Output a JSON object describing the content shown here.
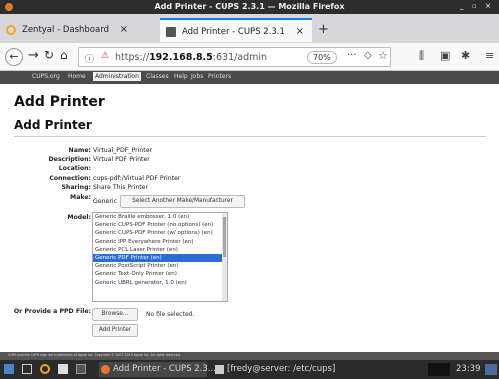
{
  "window": {
    "title": "Add Printer - CUPS 2.3.1 — Mozilla Firefox",
    "controls": "_ ▫ ×"
  },
  "tabs": [
    {
      "label": "Zentyal - Dashboard",
      "close": "×"
    },
    {
      "label": "Add Printer - CUPS 2.3.1",
      "close": "×"
    }
  ],
  "toolbar": {
    "new_tab": "+",
    "url_prefix": "https://",
    "url_host": "192.168.8.5",
    "url_path": ":631/admin",
    "zoom": "70%",
    "more": "···"
  },
  "cups_nav": [
    "CUPS.org",
    "Home",
    "Administration",
    "Classes",
    "Help",
    "Jobs",
    "Printers"
  ],
  "page": {
    "heading": "Add Printer",
    "subheading": "Add Printer",
    "fields": {
      "name_label": "Name:",
      "name_value": "Virtual_PDF_Printer",
      "description_label": "Description:",
      "description_value": "Virtual PDF Printer",
      "location_label": "Location:",
      "location_value": "",
      "connection_label": "Connection:",
      "connection_value": "cups-pdf:/Virtual PDF Printer",
      "sharing_label": "Sharing:",
      "sharing_value": "Share This Printer",
      "make_label": "Make:",
      "make_value": "Generic",
      "make_button": "Select Another Make/Manufacturer",
      "model_label": "Model:",
      "ppd_label": "Or Provide a PPD File:",
      "browse_button": "Browse...",
      "no_file": "No file selected.",
      "add_button": "Add Printer"
    },
    "models": [
      "Generic Braille embosser, 1.0 (en)",
      "Generic CUPS-PDF Printer (no options) (en)",
      "Generic CUPS-PDF Printer (w/ options) (en)",
      "Generic IPP Everywhere Printer (en)",
      "Generic PCL Laser Printer (en)",
      "Generic PDF Printer (en)",
      "Generic PostScript Printer (en)",
      "Generic Text-Only Printer (en)",
      "Generic UBRL generator, 1.0 (en)"
    ],
    "selected_model": "Generic PDF Printer (en)",
    "footer": "CUPS and the CUPS logo are trademarks of Apple Inc. Copyright © 2007-2019 Apple Inc. All rights reserved."
  },
  "taskbar": {
    "firefox_task": "Add Printer - CUPS 2.3....",
    "terminal_task": "[fredy@server: /etc/cups]",
    "clock": "23:39"
  }
}
